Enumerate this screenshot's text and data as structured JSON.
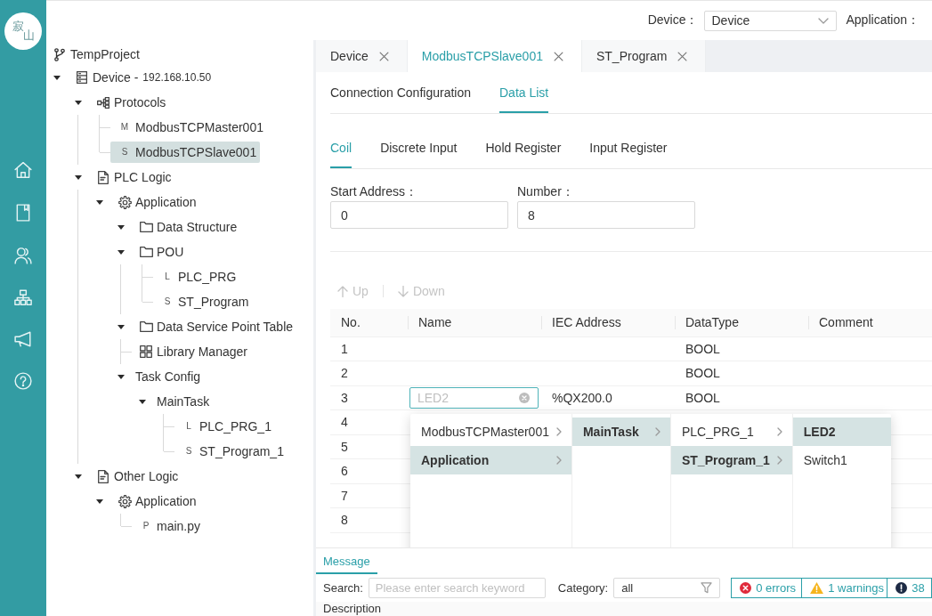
{
  "sidebar": {
    "logo": [
      "寂",
      "山"
    ],
    "nav": [
      {
        "kind": "home"
      },
      {
        "kind": "book"
      },
      {
        "kind": "users"
      },
      {
        "kind": "sitemap"
      },
      {
        "kind": "megaphone"
      },
      {
        "kind": "help"
      }
    ]
  },
  "topbar": {
    "device": {
      "label": "Device：",
      "value": "Device"
    },
    "application": {
      "label": "Application："
    }
  },
  "tree": {
    "project": "TempProject",
    "nodes": [
      {
        "label": "Device -",
        "detail": "192.168.10.50",
        "kind": "device",
        "expanded": true,
        "selected": false,
        "children": [
          {
            "label": "Protocols",
            "kind": "protocols",
            "expanded": true,
            "selected": false,
            "children": [
              {
                "label": "ModbusTCPMaster001",
                "kind": "program",
                "prefix": "M",
                "selected": false
              },
              {
                "label": "ModbusTCPSlave001",
                "kind": "program",
                "prefix": "S",
                "selected": true
              }
            ]
          },
          {
            "label": "PLC Logic",
            "kind": "logic",
            "expanded": true,
            "selected": false,
            "children": [
              {
                "label": "Application",
                "kind": "application",
                "expanded": true,
                "selected": false,
                "children": [
                  {
                    "label": "Data Structure",
                    "kind": "folder",
                    "expanded": true,
                    "selected": false
                  },
                  {
                    "label": "POU",
                    "kind": "folder",
                    "expanded": true,
                    "selected": false,
                    "children": [
                      {
                        "label": "PLC_PRG",
                        "kind": "program",
                        "prefix": "L",
                        "selected": false
                      },
                      {
                        "label": "ST_Program",
                        "kind": "program",
                        "prefix": "S",
                        "selected": false
                      }
                    ]
                  },
                  {
                    "label": "Data Service Point Table",
                    "kind": "folder",
                    "expanded": true,
                    "selected": false
                  },
                  {
                    "label": "Library Manager",
                    "kind": "library",
                    "selected": false
                  },
                  {
                    "label": "Task Config",
                    "kind": "task",
                    "expanded": true,
                    "selected": false,
                    "children": [
                      {
                        "label": "MainTask",
                        "kind": "task",
                        "expanded": true,
                        "selected": false,
                        "children": [
                          {
                            "label": "PLC_PRG_1",
                            "kind": "program",
                            "prefix": "L",
                            "selected": false
                          },
                          {
                            "label": "ST_Program_1",
                            "kind": "program",
                            "prefix": "S",
                            "selected": false
                          }
                        ]
                      }
                    ]
                  }
                ]
              }
            ]
          },
          {
            "label": "Other Logic",
            "kind": "logic",
            "expanded": true,
            "selected": false,
            "children": [
              {
                "label": "Application",
                "kind": "application",
                "expanded": true,
                "selected": false,
                "children": [
                  {
                    "label": "main.py",
                    "kind": "program",
                    "prefix": "P",
                    "selected": false
                  }
                ]
              }
            ]
          }
        ]
      }
    ]
  },
  "tabs": [
    {
      "label": "Device",
      "selected": false
    },
    {
      "label": "ModbusTCPSlave001",
      "selected": true
    },
    {
      "label": "ST_Program",
      "selected": false
    }
  ],
  "view_tabs": [
    {
      "label": "Connection Configuration",
      "selected": false
    },
    {
      "label": "Data List",
      "selected": true
    }
  ],
  "register_tabs": [
    {
      "label": "Coil",
      "selected": true
    },
    {
      "label": "Discrete Input",
      "selected": false
    },
    {
      "label": "Hold Register",
      "selected": false
    },
    {
      "label": "Input Register",
      "selected": false
    }
  ],
  "form": [
    {
      "label": "Start Address：",
      "value": "0"
    },
    {
      "label": "Number：",
      "value": "8"
    }
  ],
  "toolbar": [
    {
      "kind": "up",
      "label": "Up",
      "disabled": true
    },
    {
      "kind": "down",
      "label": "Down",
      "disabled": true
    }
  ],
  "table": {
    "columns": [
      "No.",
      "Name",
      "IEC Address",
      "DataType",
      "Comment"
    ],
    "rows": [
      {
        "no": "1",
        "data_type": "BOOL"
      },
      {
        "no": "2",
        "data_type": "BOOL"
      },
      {
        "no": "3",
        "name": {
          "placeholder": "LED2"
        },
        "iec_address": "%QX200.0",
        "data_type": "BOOL"
      },
      {
        "no": "4"
      },
      {
        "no": "5"
      },
      {
        "no": "6"
      },
      {
        "no": "7"
      },
      {
        "no": "8"
      }
    ]
  },
  "cascader": {
    "columns": [
      {
        "items": [
          {
            "label": "ModbusTCPMaster001",
            "expandable": true,
            "selected": false
          },
          {
            "label": "Application",
            "expandable": true,
            "selected": true
          }
        ]
      },
      {
        "items": [
          {
            "label": "MainTask",
            "expandable": true,
            "selected": true
          }
        ]
      },
      {
        "items": [
          {
            "label": "PLC_PRG_1",
            "expandable": true,
            "selected": false
          },
          {
            "label": "ST_Program_1",
            "expandable": true,
            "selected": true
          }
        ]
      },
      {
        "items": [
          {
            "label": "LED2",
            "expandable": false,
            "selected": true
          },
          {
            "label": "Switch1",
            "expandable": false,
            "selected": false
          }
        ]
      }
    ]
  },
  "messages": {
    "tabs": [
      {
        "label": "Message",
        "selected": true
      }
    ],
    "search": {
      "label": "Search:",
      "placeholder": "Please enter search keyword"
    },
    "category": {
      "label": "Category:",
      "value": "all"
    },
    "counters": [
      {
        "kind": "error",
        "label": "0 errors"
      },
      {
        "kind": "warning",
        "label": "1 warnings"
      },
      {
        "kind": "info",
        "label": "38"
      }
    ],
    "columns": [
      "Description"
    ]
  }
}
